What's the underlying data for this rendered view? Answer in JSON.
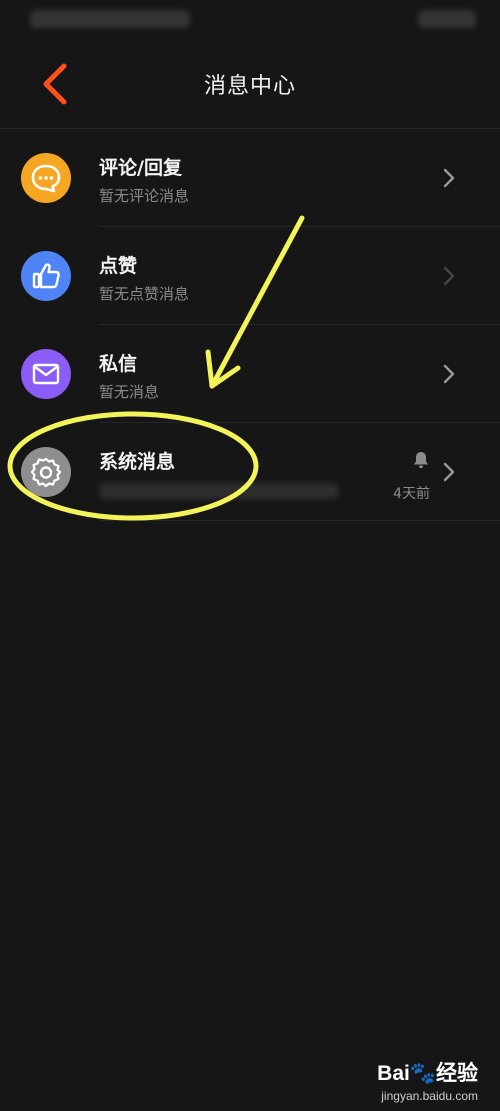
{
  "header": {
    "title": "消息中心"
  },
  "items": [
    {
      "name": "评论/回复",
      "sub": "暂无评论消息",
      "icon": "comment-icon",
      "color": "#F5A623"
    },
    {
      "name": "点赞",
      "sub": "暂无点赞消息",
      "icon": "thumbs-up-icon",
      "color": "#4F84F6"
    },
    {
      "name": "私信",
      "sub": "暂无消息",
      "icon": "mail-icon",
      "color": "#8B5CF6"
    },
    {
      "name": "系统消息",
      "sub": "",
      "icon": "gear-icon",
      "color": "#8E8E8E",
      "time": "4天前",
      "muted": true
    }
  ],
  "colors": {
    "accent": "#FF4F1A",
    "annotation": "#F3F35A",
    "background": "#161616"
  },
  "watermark": {
    "brand": "Bai",
    "brand_suffix": "经验",
    "url": "jingyan.baidu.com"
  }
}
